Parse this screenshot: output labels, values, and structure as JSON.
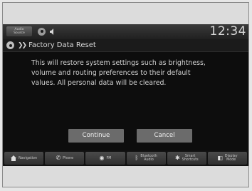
{
  "status": {
    "audio_source": "Audio\nSource",
    "clock": "12:34"
  },
  "title": {
    "text": "Factory Data Reset"
  },
  "message": {
    "lines": [
      "This will restore system settings such as brightness,",
      "volume and routing preferences to their default",
      "values. All personal data will be cleared."
    ]
  },
  "buttons": {
    "continue": "Continue",
    "cancel": "Cancel"
  },
  "nav": {
    "items": [
      {
        "label": "Navigation",
        "icon": "house-icon"
      },
      {
        "label": "Phone",
        "icon": "phone-icon"
      },
      {
        "label": "FM",
        "icon": "radio-icon"
      },
      {
        "label": "Bluetooth\nAudio",
        "icon": "bluetooth-icon"
      },
      {
        "label": "Smart\nShortcuts",
        "icon": "shortcuts-icon"
      },
      {
        "label": "Display\nMode",
        "icon": "display-mode-icon"
      }
    ]
  }
}
